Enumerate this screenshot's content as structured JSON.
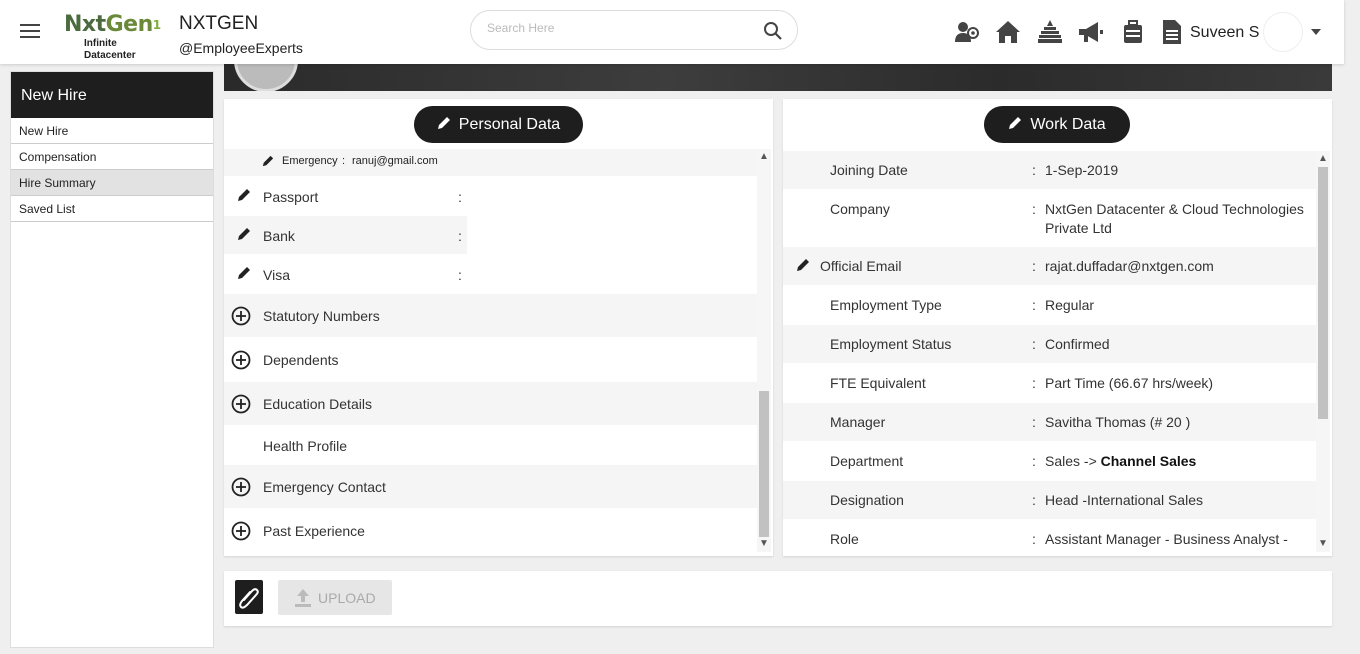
{
  "header": {
    "logo_text_a": "Nxt",
    "logo_text_b": "Gen",
    "logo_sub": "Infinite Datacenter",
    "company_name": "NXTGEN",
    "company_tag": "@EmployeeExperts",
    "search_placeholder": "Search Here",
    "user_name": "Suveen S"
  },
  "sidebar": {
    "title": "New Hire",
    "items": [
      {
        "label": "New Hire"
      },
      {
        "label": "Compensation"
      },
      {
        "label": "Hire Summary"
      },
      {
        "label": "Saved List"
      }
    ]
  },
  "personal": {
    "title": "Personal Data",
    "emergency_label": "Emergency",
    "emergency_sep": ":",
    "emergency_value": "ranuj@gmail.com",
    "fields": [
      {
        "label": "Passport",
        "sep": ":"
      },
      {
        "label": "Bank",
        "sep": ":"
      },
      {
        "label": "Visa",
        "sep": ":"
      }
    ],
    "sections": [
      {
        "label": "Statutory Numbers"
      },
      {
        "label": "Dependents"
      },
      {
        "label": "Education Details"
      },
      {
        "label": "Health Profile"
      },
      {
        "label": "Emergency Contact"
      },
      {
        "label": "Past Experience"
      }
    ]
  },
  "work": {
    "title": "Work Data",
    "rows": [
      {
        "label": "Joining Date",
        "sep": ":",
        "value": "1-Sep-2019"
      },
      {
        "label": "Company",
        "sep": ":",
        "value": "NxtGen Datacenter & Cloud Technologies Private Ltd"
      },
      {
        "label": "Official Email",
        "sep": ":",
        "value": "rajat.duffadar@nxtgen.com"
      },
      {
        "label": "Employment Type",
        "sep": ":",
        "value": "Regular"
      },
      {
        "label": "Employment Status",
        "sep": ":",
        "value": "Confirmed"
      },
      {
        "label": "FTE Equivalent",
        "sep": ":",
        "value": "Part Time (66.67 hrs/week)"
      },
      {
        "label": "Manager",
        "sep": ":",
        "value": "Savitha Thomas (# 20 )"
      },
      {
        "label": "Department",
        "sep": ":",
        "value_prefix": "Sales -> ",
        "value_bold": "Channel Sales"
      },
      {
        "label": "Designation",
        "sep": ":",
        "value": "Head -International Sales"
      },
      {
        "label": "Role",
        "sep": ":",
        "value": "Assistant Manager - Business Analyst -"
      }
    ]
  },
  "upload": {
    "label": "UPLOAD"
  },
  "colors": {
    "dark": "#1e1e1e",
    "accent_green": "#4b6b3f"
  },
  "icons": [
    "menu-icon",
    "search-icon",
    "users-icon",
    "home-icon",
    "temple-icon",
    "megaphone-icon",
    "luggage-icon",
    "document-icon",
    "pencil-icon",
    "plus-circle-icon",
    "paperclip-icon",
    "upload-icon"
  ]
}
